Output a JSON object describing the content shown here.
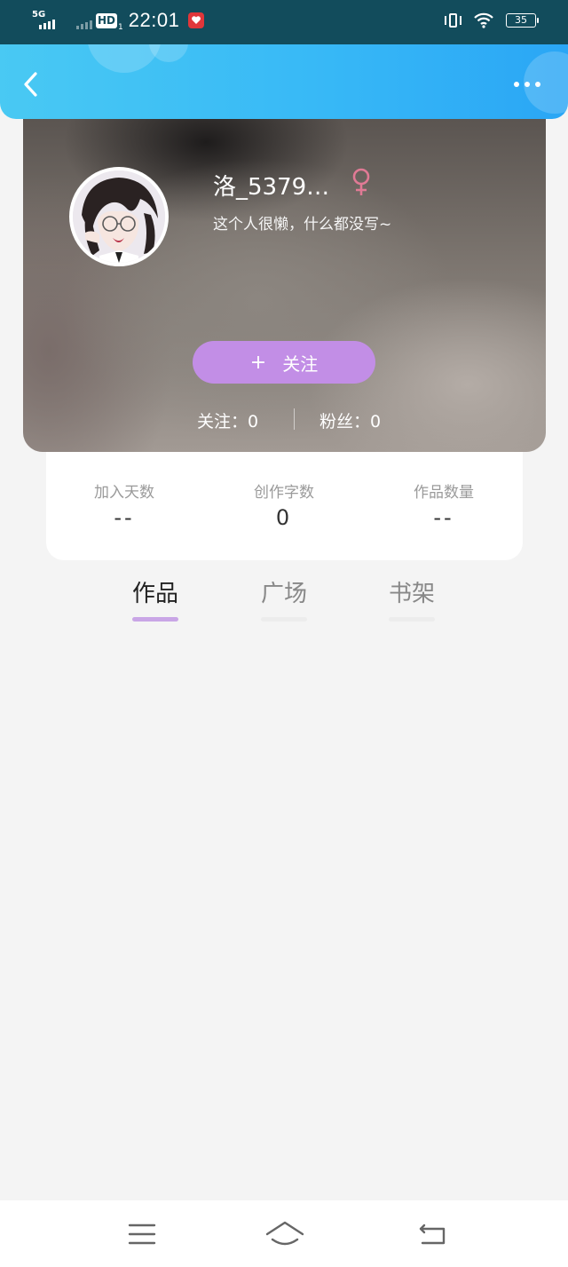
{
  "status_bar": {
    "network": "5G",
    "hd": "HD",
    "hd_sub": "1",
    "time": "22:01",
    "battery": "35",
    "colors": {
      "background": "#124c5c"
    }
  },
  "header": {
    "back_icon": "chevron-left-icon",
    "more_icon": "more-dots-icon",
    "colors": {
      "gradient_start": "#49c9f3",
      "gradient_end": "#2aa6f5"
    }
  },
  "profile": {
    "username": "洛_5379…",
    "gender_symbol": "♀",
    "bio": "这个人很懒，什么都没写~",
    "follow_button": {
      "plus": "+",
      "label": "关注"
    },
    "following": "关注：0",
    "fans": "粉丝：0",
    "colors": {
      "follow_button": "#c28ee6",
      "gender": "#e07a95"
    }
  },
  "stats": [
    {
      "label": "加入天数",
      "value": "--"
    },
    {
      "label": "创作字数",
      "value": "0"
    },
    {
      "label": "作品数量",
      "value": "--"
    }
  ],
  "tabs": [
    {
      "label": "作品",
      "active": true
    },
    {
      "label": "广场",
      "active": false
    },
    {
      "label": "书架",
      "active": false
    }
  ],
  "nav_bar": {
    "menu_icon": "menu-icon",
    "home_icon": "home-icon",
    "back_icon": "back-icon"
  }
}
